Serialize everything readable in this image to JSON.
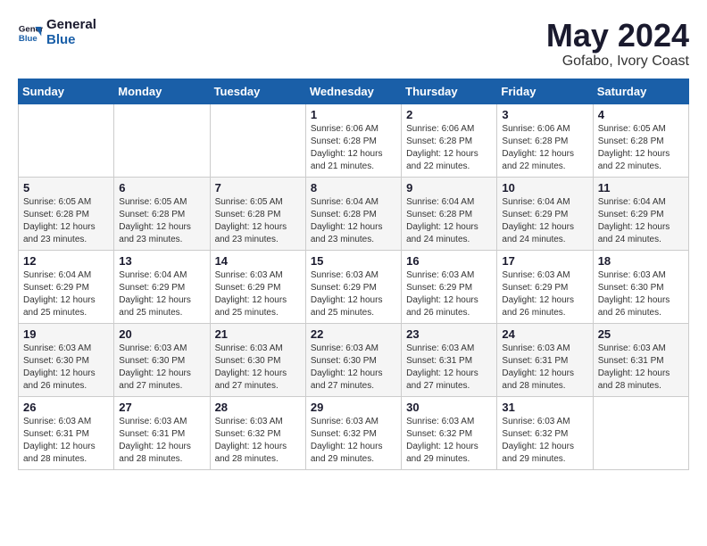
{
  "header": {
    "logo": {
      "general": "General",
      "blue": "Blue"
    },
    "title": "May 2024",
    "subtitle": "Gofabo, Ivory Coast"
  },
  "calendar": {
    "days_of_week": [
      "Sunday",
      "Monday",
      "Tuesday",
      "Wednesday",
      "Thursday",
      "Friday",
      "Saturday"
    ],
    "weeks": [
      [
        {
          "day": "",
          "info": ""
        },
        {
          "day": "",
          "info": ""
        },
        {
          "day": "",
          "info": ""
        },
        {
          "day": "1",
          "info": "Sunrise: 6:06 AM\nSunset: 6:28 PM\nDaylight: 12 hours\nand 21 minutes."
        },
        {
          "day": "2",
          "info": "Sunrise: 6:06 AM\nSunset: 6:28 PM\nDaylight: 12 hours\nand 22 minutes."
        },
        {
          "day": "3",
          "info": "Sunrise: 6:06 AM\nSunset: 6:28 PM\nDaylight: 12 hours\nand 22 minutes."
        },
        {
          "day": "4",
          "info": "Sunrise: 6:05 AM\nSunset: 6:28 PM\nDaylight: 12 hours\nand 22 minutes."
        }
      ],
      [
        {
          "day": "5",
          "info": "Sunrise: 6:05 AM\nSunset: 6:28 PM\nDaylight: 12 hours\nand 23 minutes."
        },
        {
          "day": "6",
          "info": "Sunrise: 6:05 AM\nSunset: 6:28 PM\nDaylight: 12 hours\nand 23 minutes."
        },
        {
          "day": "7",
          "info": "Sunrise: 6:05 AM\nSunset: 6:28 PM\nDaylight: 12 hours\nand 23 minutes."
        },
        {
          "day": "8",
          "info": "Sunrise: 6:04 AM\nSunset: 6:28 PM\nDaylight: 12 hours\nand 23 minutes."
        },
        {
          "day": "9",
          "info": "Sunrise: 6:04 AM\nSunset: 6:28 PM\nDaylight: 12 hours\nand 24 minutes."
        },
        {
          "day": "10",
          "info": "Sunrise: 6:04 AM\nSunset: 6:29 PM\nDaylight: 12 hours\nand 24 minutes."
        },
        {
          "day": "11",
          "info": "Sunrise: 6:04 AM\nSunset: 6:29 PM\nDaylight: 12 hours\nand 24 minutes."
        }
      ],
      [
        {
          "day": "12",
          "info": "Sunrise: 6:04 AM\nSunset: 6:29 PM\nDaylight: 12 hours\nand 25 minutes."
        },
        {
          "day": "13",
          "info": "Sunrise: 6:04 AM\nSunset: 6:29 PM\nDaylight: 12 hours\nand 25 minutes."
        },
        {
          "day": "14",
          "info": "Sunrise: 6:03 AM\nSunset: 6:29 PM\nDaylight: 12 hours\nand 25 minutes."
        },
        {
          "day": "15",
          "info": "Sunrise: 6:03 AM\nSunset: 6:29 PM\nDaylight: 12 hours\nand 25 minutes."
        },
        {
          "day": "16",
          "info": "Sunrise: 6:03 AM\nSunset: 6:29 PM\nDaylight: 12 hours\nand 26 minutes."
        },
        {
          "day": "17",
          "info": "Sunrise: 6:03 AM\nSunset: 6:29 PM\nDaylight: 12 hours\nand 26 minutes."
        },
        {
          "day": "18",
          "info": "Sunrise: 6:03 AM\nSunset: 6:30 PM\nDaylight: 12 hours\nand 26 minutes."
        }
      ],
      [
        {
          "day": "19",
          "info": "Sunrise: 6:03 AM\nSunset: 6:30 PM\nDaylight: 12 hours\nand 26 minutes."
        },
        {
          "day": "20",
          "info": "Sunrise: 6:03 AM\nSunset: 6:30 PM\nDaylight: 12 hours\nand 27 minutes."
        },
        {
          "day": "21",
          "info": "Sunrise: 6:03 AM\nSunset: 6:30 PM\nDaylight: 12 hours\nand 27 minutes."
        },
        {
          "day": "22",
          "info": "Sunrise: 6:03 AM\nSunset: 6:30 PM\nDaylight: 12 hours\nand 27 minutes."
        },
        {
          "day": "23",
          "info": "Sunrise: 6:03 AM\nSunset: 6:31 PM\nDaylight: 12 hours\nand 27 minutes."
        },
        {
          "day": "24",
          "info": "Sunrise: 6:03 AM\nSunset: 6:31 PM\nDaylight: 12 hours\nand 28 minutes."
        },
        {
          "day": "25",
          "info": "Sunrise: 6:03 AM\nSunset: 6:31 PM\nDaylight: 12 hours\nand 28 minutes."
        }
      ],
      [
        {
          "day": "26",
          "info": "Sunrise: 6:03 AM\nSunset: 6:31 PM\nDaylight: 12 hours\nand 28 minutes."
        },
        {
          "day": "27",
          "info": "Sunrise: 6:03 AM\nSunset: 6:31 PM\nDaylight: 12 hours\nand 28 minutes."
        },
        {
          "day": "28",
          "info": "Sunrise: 6:03 AM\nSunset: 6:32 PM\nDaylight: 12 hours\nand 28 minutes."
        },
        {
          "day": "29",
          "info": "Sunrise: 6:03 AM\nSunset: 6:32 PM\nDaylight: 12 hours\nand 29 minutes."
        },
        {
          "day": "30",
          "info": "Sunrise: 6:03 AM\nSunset: 6:32 PM\nDaylight: 12 hours\nand 29 minutes."
        },
        {
          "day": "31",
          "info": "Sunrise: 6:03 AM\nSunset: 6:32 PM\nDaylight: 12 hours\nand 29 minutes."
        },
        {
          "day": "",
          "info": ""
        }
      ]
    ]
  }
}
